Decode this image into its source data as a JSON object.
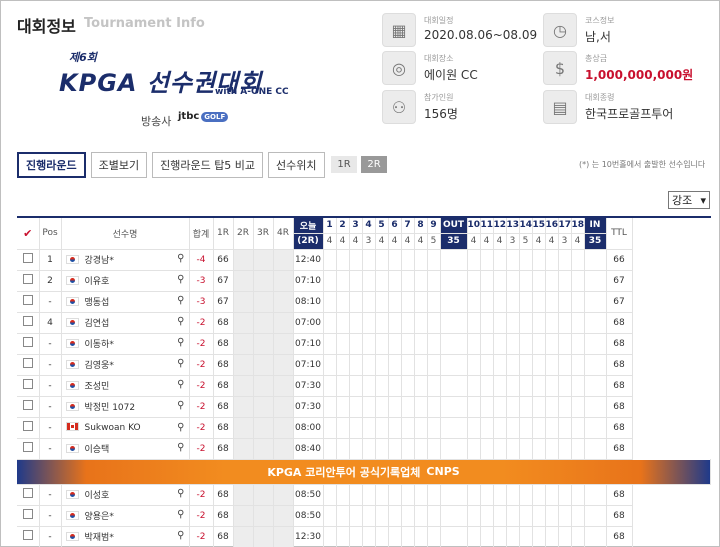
{
  "header": {
    "title": "대회정보",
    "subtitle": "Tournament Info",
    "logo": {
      "line1": "제6회",
      "line2": "KPGA 선수권대회",
      "line3": "with A-ONE CC"
    },
    "broadcaster_label": "방송사",
    "broadcaster_logo": "jtbc",
    "broadcaster_logo_badge": "GOLF"
  },
  "info": [
    {
      "icon": "calendar-icon",
      "label": "대회일정",
      "value": "2020.08.06~08.09"
    },
    {
      "icon": "clock-icon",
      "label": "코스정보",
      "value": "남,서"
    },
    {
      "icon": "globe-icon",
      "label": "대회장소",
      "value": "에이원 CC"
    },
    {
      "icon": "dollar-icon",
      "label": "총상금",
      "value": "1,000,000,000원"
    },
    {
      "icon": "players-icon",
      "label": "참가인원",
      "value": "156명"
    },
    {
      "icon": "tour-icon",
      "label": "대회종령",
      "value": "한국프로골프투어"
    }
  ],
  "tabs": [
    "진행라운드",
    "조별보기",
    "진행라운드 탑5 비교",
    "선수위치"
  ],
  "round_tabs": [
    "1R",
    "2R"
  ],
  "note": "(*) 는 10번홀에서 출발한 선수입니다",
  "select": {
    "value": "강조",
    "arrow": "▾"
  },
  "table": {
    "check_header": "✔",
    "headers": {
      "pos": "Pos",
      "name": "선수명",
      "total": "합계",
      "r1": "1R",
      "r2": "2R",
      "r3": "3R",
      "r4": "4R",
      "today": "오늘",
      "today_sub": "(2R)",
      "out": "OUT",
      "in": "IN",
      "ttl": "TTL"
    },
    "holes_front": [
      "1",
      "2",
      "3",
      "4",
      "5",
      "6",
      "7",
      "8",
      "9"
    ],
    "holes_back": [
      "10",
      "11",
      "12",
      "13",
      "14",
      "15",
      "16",
      "17",
      "18"
    ],
    "par_front": [
      "4",
      "4",
      "4",
      "3",
      "4",
      "4",
      "4",
      "4",
      "5"
    ],
    "par_back": [
      "4",
      "4",
      "4",
      "3",
      "5",
      "4",
      "4",
      "3",
      "4"
    ],
    "par_out": "35",
    "par_in": "35",
    "rows": [
      {
        "pos": "1",
        "flag": "kr",
        "name": "강경남*",
        "total": "-4",
        "r1": "66",
        "today": "12:40",
        "ttl": "66"
      },
      {
        "pos": "2",
        "flag": "kr",
        "name": "이유호",
        "total": "-3",
        "r1": "67",
        "today": "07:10",
        "ttl": "67"
      },
      {
        "pos": "-",
        "flag": "kr",
        "name": "맹동섭",
        "total": "-3",
        "r1": "67",
        "today": "08:10",
        "ttl": "67"
      },
      {
        "pos": "4",
        "flag": "kr",
        "name": "김연섭",
        "total": "-2",
        "r1": "68",
        "today": "07:00",
        "ttl": "68"
      },
      {
        "pos": "-",
        "flag": "kr",
        "name": "이동하*",
        "total": "-2",
        "r1": "68",
        "today": "07:10",
        "ttl": "68"
      },
      {
        "pos": "-",
        "flag": "kr",
        "name": "김영웅*",
        "total": "-2",
        "r1": "68",
        "today": "07:10",
        "ttl": "68"
      },
      {
        "pos": "-",
        "flag": "kr",
        "name": "조성민",
        "total": "-2",
        "r1": "68",
        "today": "07:30",
        "ttl": "68"
      },
      {
        "pos": "-",
        "flag": "kr",
        "name": "박정민 1072",
        "total": "-2",
        "r1": "68",
        "today": "07:30",
        "ttl": "68"
      },
      {
        "pos": "-",
        "flag": "ca",
        "name": "Sukwoan KO",
        "total": "-2",
        "r1": "68",
        "today": "08:00",
        "ttl": "68"
      },
      {
        "pos": "-",
        "flag": "kr",
        "name": "이승택",
        "total": "-2",
        "r1": "68",
        "today": "08:40",
        "ttl": "68"
      }
    ],
    "banner": {
      "text": "KPGA 코리안투어 공식기록업체",
      "sponsor": "CNPS"
    },
    "rows2": [
      {
        "pos": "-",
        "flag": "kr",
        "name": "이성호",
        "total": "-2",
        "r1": "68",
        "today": "08:50",
        "ttl": "68"
      },
      {
        "pos": "-",
        "flag": "kr",
        "name": "양용은*",
        "total": "-2",
        "r1": "68",
        "today": "08:50",
        "ttl": "68"
      },
      {
        "pos": "-",
        "flag": "kr",
        "name": "박재범*",
        "total": "-2",
        "r1": "68",
        "today": "12:30",
        "ttl": "68"
      }
    ]
  }
}
